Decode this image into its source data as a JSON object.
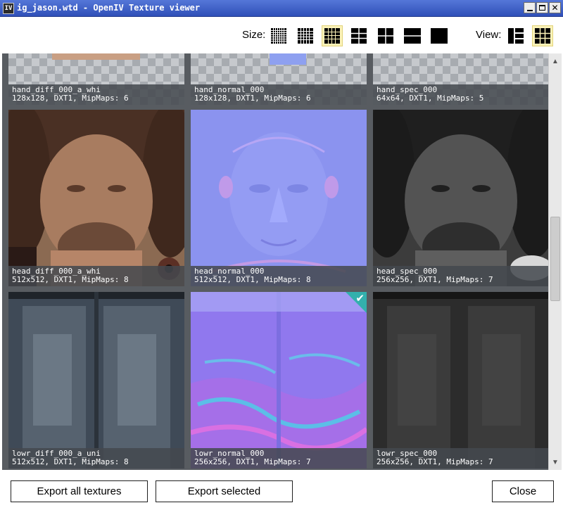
{
  "window": {
    "title": "ig_jason.wtd - OpenIV Texture viewer",
    "icon": "openiv-app-icon",
    "icon_text": "IV"
  },
  "toolbar": {
    "size_label": "Size:",
    "view_label": "View:",
    "size_options": [
      "size-7x7-icon",
      "size-6x6-icon",
      "size-5x5-icon",
      "size-4x4-icon",
      "size-3x3-icon",
      "size-2x2-icon",
      "size-1x1-icon"
    ],
    "selected_size": "size-5x5-icon",
    "view_options": [
      "list-view-icon",
      "grid-view-icon"
    ],
    "selected_view": "grid-view-icon",
    "active_color": "#fbf2b8"
  },
  "textures": [
    {
      "name": "hand_diff_000_a_whi",
      "info": "128x128, DXT1, MipMaps: 6",
      "kind": "diffuse",
      "selected": false
    },
    {
      "name": "hand_normal_000",
      "info": "128x128, DXT1, MipMaps: 6",
      "kind": "normal",
      "selected": false
    },
    {
      "name": "hand_spec_000",
      "info": "64x64, DXT1, MipMaps: 5",
      "kind": "specular",
      "selected": false
    },
    {
      "name": "head_diff_000_a_whi",
      "info": "512x512, DXT1, MipMaps: 8",
      "kind": "diffuse",
      "selected": false
    },
    {
      "name": "head_normal_000",
      "info": "512x512, DXT1, MipMaps: 8",
      "kind": "normal",
      "selected": false
    },
    {
      "name": "head_spec_000",
      "info": "256x256, DXT1, MipMaps: 7",
      "kind": "specular",
      "selected": false
    },
    {
      "name": "lowr_diff_000_a_uni",
      "info": "512x512, DXT1, MipMaps: 8",
      "kind": "diffuse",
      "selected": false
    },
    {
      "name": "lowr_normal_000",
      "info": "256x256, DXT1, MipMaps: 7",
      "kind": "normal",
      "selected": true
    },
    {
      "name": "lowr_spec_000",
      "info": "256x256, DXT1, MipMaps: 7",
      "kind": "specular",
      "selected": false
    }
  ],
  "selection_color": "#33b0ad",
  "footer": {
    "export_all_label": "Export all textures",
    "export_selected_label": "Export selected",
    "close_label": "Close"
  }
}
